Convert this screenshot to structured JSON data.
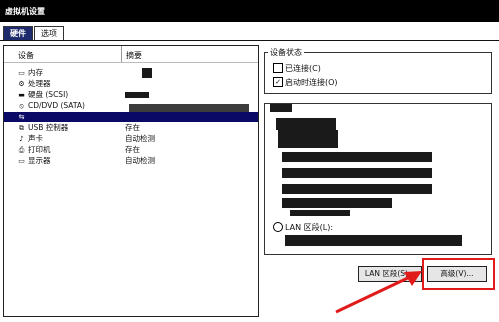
{
  "window": {
    "title": "虚拟机设置"
  },
  "tabs": [
    {
      "label": "硬件",
      "active": true
    },
    {
      "label": "选项",
      "active": false
    }
  ],
  "device_list": {
    "headers": {
      "device": "设备",
      "summary": "摘要"
    },
    "rows": [
      {
        "icon": "memory-icon",
        "name": "内存",
        "summary": ""
      },
      {
        "icon": "processor-icon",
        "name": "处理器",
        "summary": ""
      },
      {
        "icon": "hard-disk-icon",
        "name": "硬盘 (SCSI)",
        "summary": ""
      },
      {
        "icon": "cd-dvd-icon",
        "name": "CD/DVD (SATA)",
        "summary": ""
      },
      {
        "icon": "network-adapter-icon",
        "name": "",
        "summary": "",
        "selected": true
      },
      {
        "icon": "usb-controller-icon",
        "name": "USB 控制器",
        "summary": "存在"
      },
      {
        "icon": "sound-card-icon",
        "name": "声卡",
        "summary": "自动检测"
      },
      {
        "icon": "printer-icon",
        "name": "打印机",
        "summary": "存在"
      },
      {
        "icon": "display-icon",
        "name": "显示器",
        "summary": "自动检测"
      }
    ]
  },
  "device_status": {
    "title": "设备状态",
    "connected_label": "已连接(C)",
    "connected_checked": false,
    "connect_at_power_on_label": "启动时连接(O)",
    "connect_at_power_on_checked": true
  },
  "network_connection": {
    "lan_segment_label": "LAN 区段(L):"
  },
  "buttons": {
    "lan_segments": "LAN 区段(S)...",
    "advanced": "高级(V)..."
  },
  "colors": {
    "selection": "#0a0a66",
    "tab_active": "#1d2a6b",
    "annotation": "#e11a1a"
  }
}
